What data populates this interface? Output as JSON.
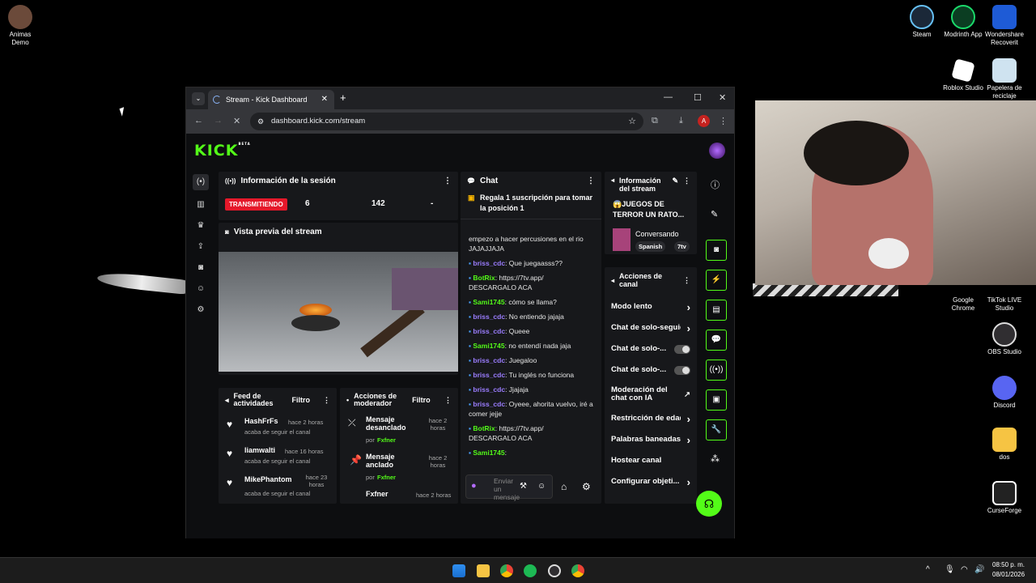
{
  "desktop": {
    "icons_left": [
      {
        "label": "Animas Demo"
      }
    ],
    "icons_right": [
      {
        "label": "Steam"
      },
      {
        "label": "Modrinth App"
      },
      {
        "label": "Wondershare Recoverit"
      },
      {
        "label": "Roblox Studio"
      },
      {
        "label": "Papelera de reciclaje"
      },
      {
        "label": "Google Chrome"
      },
      {
        "label": "TikTok LIVE Studio"
      },
      {
        "label": "OBS Studio"
      },
      {
        "label": "Discord"
      },
      {
        "label": "dos"
      },
      {
        "label": "CurseForge"
      }
    ]
  },
  "browser": {
    "tab_title": "Stream - Kick Dashboard",
    "url": "dashboard.kick.com/stream",
    "profile_initial": "A"
  },
  "kick": {
    "logo": "KICK",
    "logo_badge": "BETA",
    "session": {
      "title": "Información de la sesión",
      "status": "TRANSMITIENDO",
      "viewers": "6",
      "followers": "142",
      "other": "-"
    },
    "preview": {
      "title": "Vista previa del stream"
    },
    "feed": {
      "title": "Feed de actividades",
      "filter": "Filtro",
      "items": [
        {
          "name": "HashFrFs",
          "time": "hace 2 horas",
          "desc": "acaba de seguir el canal"
        },
        {
          "name": "liamwalti",
          "time": "hace 16 horas",
          "desc": "acaba de seguir el canal"
        },
        {
          "name": "MikePhantom",
          "time": "hace 23 horas",
          "desc": "acaba de seguir el canal"
        }
      ]
    },
    "mod": {
      "title": "Acciones de moderador",
      "filter": "Filtro",
      "items": [
        {
          "action": "Mensaje desanclado",
          "by": "por",
          "user": "Fxfner",
          "time": "hace 2 horas"
        },
        {
          "action": "Mensaje anclado",
          "by": "por",
          "user": "Fxfner",
          "time": "hace 2 horas"
        },
        {
          "action": "Fxfner",
          "by": "",
          "user": "",
          "time": "hace 2 horas"
        }
      ]
    },
    "chat": {
      "title": "Chat",
      "pinned": "Regala 1 suscripción para tomar la posición 1",
      "messages": [
        {
          "user": "",
          "text": "empezo a hacer percusiones en el rio JAJAJJAJA",
          "color": "none"
        },
        {
          "user": "briss_cdc",
          "text": ": Que juegaasss??",
          "color": "blue"
        },
        {
          "user": "BotRix",
          "text": ": https://7tv.app/ DESCARGALO ACA",
          "color": "green"
        },
        {
          "user": "Sami1745",
          "text": ": cómo se llama?",
          "color": "green"
        },
        {
          "user": "briss_cdc",
          "text": ": No entiendo jajaja",
          "color": "blue"
        },
        {
          "user": "briss_cdc",
          "text": ": Queee",
          "color": "blue"
        },
        {
          "user": "Sami1745",
          "text": ": no entendí nada jaja",
          "color": "green"
        },
        {
          "user": "briss_cdc",
          "text": ": Juegaloo",
          "color": "blue"
        },
        {
          "user": "briss_cdc",
          "text": ": Tu inglés no funciona",
          "color": "blue"
        },
        {
          "user": "briss_cdc",
          "text": ": Jjajaja",
          "color": "blue"
        },
        {
          "user": "briss_cdc",
          "text": ": Oyeee, ahorita vuelvo, iré a comer jejje",
          "color": "blue"
        },
        {
          "user": "BotRix",
          "text": ": https://7tv.app/ DESCARGALO ACA",
          "color": "green"
        },
        {
          "user": "Sami1745",
          "text": ":",
          "color": "green"
        }
      ],
      "input_placeholder": "Enviar un mensaje"
    },
    "stream_info": {
      "title": "Información del stream",
      "stream_title": "😱JUEGOS DE TERROR UN RATO...",
      "category": "Conversando",
      "tags": [
        "Spanish",
        "7tv"
      ]
    },
    "channel_actions": {
      "title": "Acciones de canal",
      "items": [
        {
          "label": "Modo lento",
          "kind": "chevron"
        },
        {
          "label": "Chat de solo-seguid",
          "kind": "chevron"
        },
        {
          "label": "Chat de solo-...",
          "kind": "toggle"
        },
        {
          "label": "Chat de solo-...",
          "kind": "toggle"
        },
        {
          "label": "Moderación del chat con IA",
          "kind": "external"
        },
        {
          "label": "Restricción de edad",
          "kind": "chevron"
        },
        {
          "label": "Palabras baneadas",
          "kind": "chevron"
        },
        {
          "label": "Hostear canal",
          "kind": "none"
        },
        {
          "label": "Configurar objeti...",
          "kind": "chevron"
        }
      ]
    }
  },
  "taskbar": {
    "time": "08:50 p. m.",
    "date": "08/01/2026"
  },
  "colors": {
    "kick_green": "#53fc18",
    "live_red": "#e5182a",
    "username_purple": "#9b7dff"
  }
}
